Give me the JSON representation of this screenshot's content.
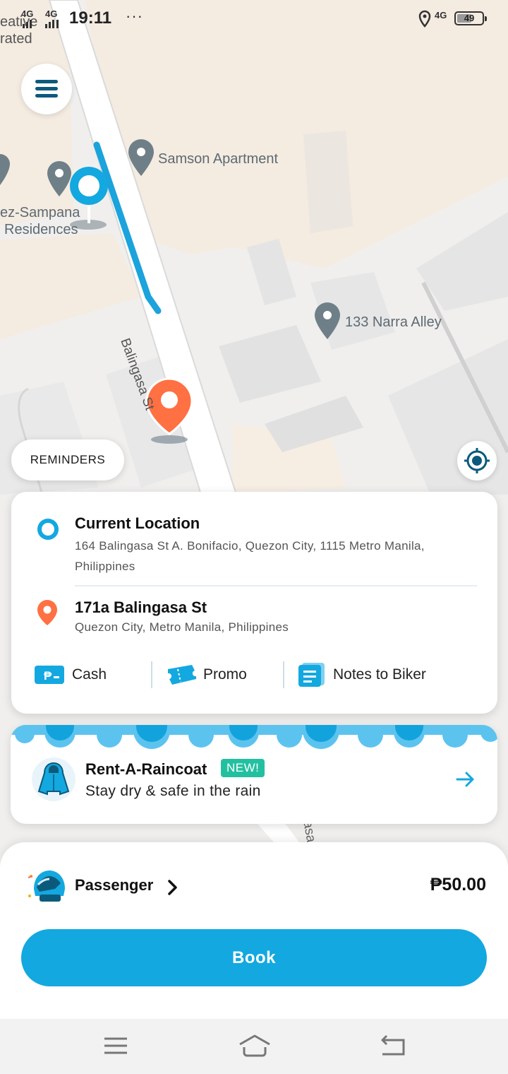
{
  "status_bar": {
    "time": "19:11",
    "signal_1": "4G",
    "signal_2": "4G",
    "more": "···",
    "right_network": "4G",
    "battery": "49"
  },
  "map": {
    "labels": {
      "top_left_1": "eative",
      "top_left_2": "rated",
      "samson": "Samson Apartment",
      "residence_1": "ez-Sampana",
      "residence_2": "Residences",
      "narra": "133 Narra Alley",
      "street": "Balingasa St",
      "street_lower": "asa"
    },
    "colors": {
      "route": "#1aa3dc",
      "origin": "#13a8e0",
      "destination": "#ff7043"
    }
  },
  "reminders_label": "REMINDERS",
  "trip": {
    "origin": {
      "title": "Current Location",
      "address": "164 Balingasa St A. Bonifacio, Quezon City, 1115 Metro Manila, Philippines"
    },
    "destination": {
      "title": "171a Balingasa St",
      "address": "Quezon City, Metro Manila, Philippines"
    },
    "options": {
      "payment": "Cash",
      "promo": "Promo",
      "notes": "Notes to Biker"
    }
  },
  "promo_card": {
    "title": "Rent-A-Raincoat",
    "badge": "NEW!",
    "subtitle": "Stay dry & safe in the rain"
  },
  "booking": {
    "service": "Passenger",
    "price": "₱50.00",
    "book_label": "Book"
  },
  "theme": {
    "accent": "#13a8e0",
    "new_badge": "#23c0a0"
  }
}
